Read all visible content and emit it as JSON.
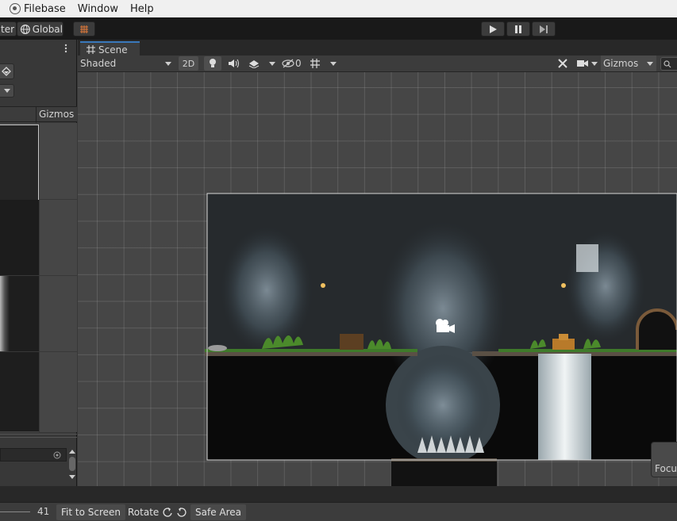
{
  "menu": {
    "app": "Filebase",
    "items": [
      "Window",
      "Help"
    ]
  },
  "toolbar": {
    "center_label": "ter",
    "global_label": "Global"
  },
  "left_panel": {
    "gizmos_label": "Gizmos"
  },
  "scene": {
    "tab_label": "Scene",
    "shading_mode": "Shaded",
    "toggle_2d": "2D",
    "hidden_count": "0",
    "gizmos_label": "Gizmos",
    "focus_label": "Focus"
  },
  "bottom": {
    "scale_value": "41",
    "fit_label": "Fit to Screen",
    "rotate_label": "Rotate",
    "safe_area_label": "Safe Area"
  },
  "icons": [
    "app-icon",
    "globe-icon",
    "grid-snap-icon",
    "play-icon",
    "pause-icon",
    "step-icon",
    "more-icon",
    "grid-icon",
    "light-icon",
    "audio-icon",
    "effects-icon",
    "visibility-icon",
    "grid-toggle-icon",
    "tools-icon",
    "camera-icon",
    "search-icon",
    "camera-gizmo-icon",
    "target-icon",
    "rotate-ccw-icon",
    "rotate-cw-icon"
  ],
  "colors": {
    "accent": "#3a79bb",
    "toolbar": "#191919",
    "panel": "#383838",
    "viewport": "#464646"
  }
}
